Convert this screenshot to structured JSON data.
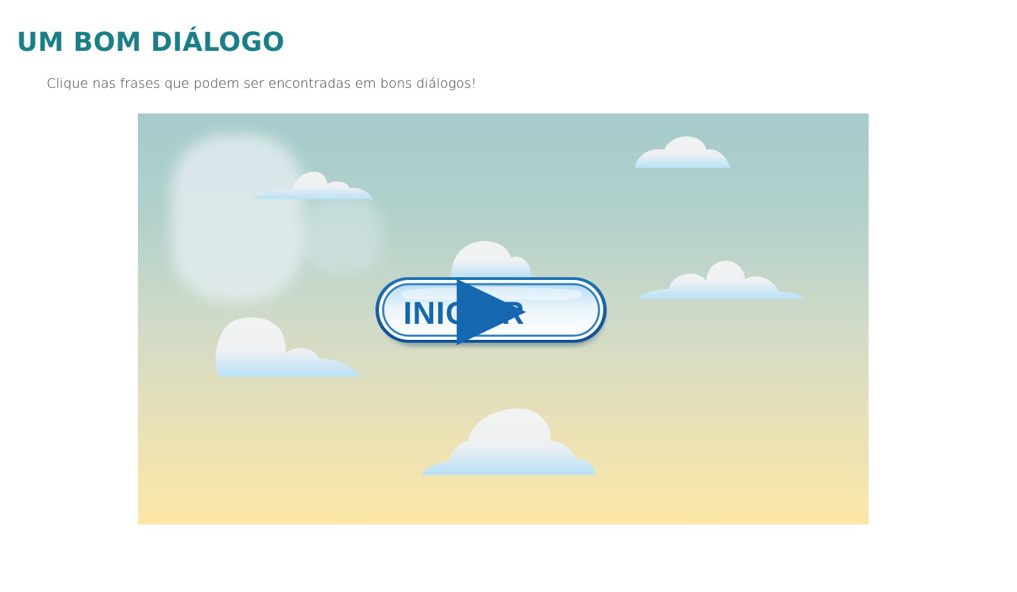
{
  "header": {
    "title": "UM BOM DIÁLOGO",
    "instruction": "Clique nas frases que podem ser encontradas em bons diálogos!"
  },
  "activity": {
    "start_button_label": "INICIAR",
    "start_button_icon": "play-icon"
  },
  "colors": {
    "title": "#1a8088",
    "button_text": "#1568b0",
    "sky_top": "#a6cbcb",
    "sky_bottom": "#fde7a7"
  }
}
